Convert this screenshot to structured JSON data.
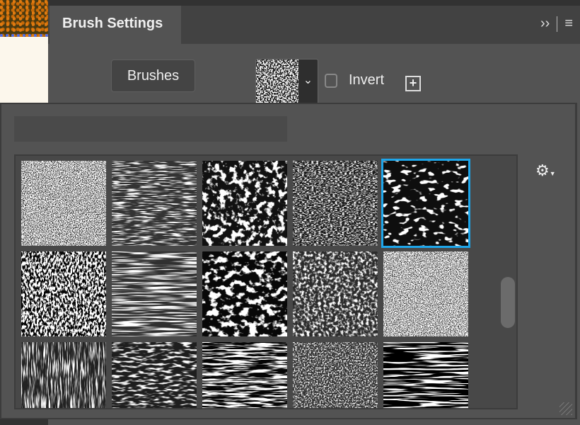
{
  "panel": {
    "title": "Brush Settings",
    "expand_icon": "double-chevron-right-icon",
    "menu_icon": "hamburger-menu-icon"
  },
  "toolbar": {
    "brushes_label": "Brushes",
    "invert_label": "Invert",
    "invert_checked": false,
    "dropdown_icon": "chevron-down-icon",
    "new_texture_icon": "plus-square-icon"
  },
  "picker": {
    "search_value": "",
    "settings_icon": "gear-icon",
    "selected_index": 4,
    "scroll_position": 0.45,
    "textures": [
      "texture-1",
      "texture-2",
      "texture-3",
      "texture-4",
      "texture-5",
      "texture-6",
      "texture-7",
      "texture-8",
      "texture-9",
      "texture-10",
      "texture-11",
      "texture-12",
      "texture-13",
      "texture-14",
      "texture-15"
    ]
  },
  "colors": {
    "accent": "#1ea6ea",
    "panel": "#535353",
    "tabbar": "#424242"
  }
}
